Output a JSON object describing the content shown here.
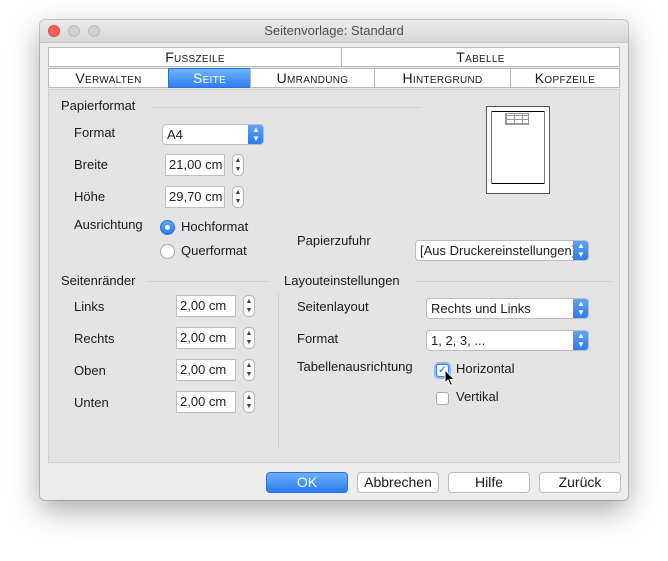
{
  "window": {
    "title": "Seitenvorlage: Standard"
  },
  "tabs_row1": [
    {
      "label": "Fusszeile"
    },
    {
      "label": "Tabelle"
    }
  ],
  "tabs_row2": [
    {
      "label": "Verwalten",
      "active": false
    },
    {
      "label": "Seite",
      "active": true
    },
    {
      "label": "Umrandung",
      "active": false
    },
    {
      "label": "Hintergrund",
      "active": false
    },
    {
      "label": "Kopfzeile",
      "active": false
    }
  ],
  "paper": {
    "heading": "Papierformat",
    "format_label": "Format",
    "format_value": "A4",
    "width_label": "Breite",
    "width_value": "21,00 cm",
    "height_label": "Höhe",
    "height_value": "29,70 cm",
    "orientation_label": "Ausrichtung",
    "portrait_label": "Hochformat",
    "portrait_selected": true,
    "landscape_label": "Querformat",
    "landscape_selected": false,
    "tray_label": "Papierzufuhr",
    "tray_value": "[Aus Druckereinstellungen]"
  },
  "margins": {
    "heading": "Seitenränder",
    "left_label": "Links",
    "left_value": "2,00 cm",
    "right_label": "Rechts",
    "right_value": "2,00 cm",
    "top_label": "Oben",
    "top_value": "2,00 cm",
    "bottom_label": "Unten",
    "bottom_value": "2,00 cm"
  },
  "layout": {
    "heading": "Layouteinstellungen",
    "page_layout_label": "Seitenlayout",
    "page_layout_value": "Rechts und Links",
    "format_label": "Format",
    "format_value": "1, 2, 3, ...",
    "table_alignment_label": "Tabellenausrichtung",
    "horizontal_label": "Horizontal",
    "horizontal_checked": true,
    "vertical_label": "Vertikal",
    "vertical_checked": false
  },
  "buttons": {
    "ok": "OK",
    "cancel": "Abbrechen",
    "help": "Hilfe",
    "back": "Zurück"
  },
  "colors": {
    "accent": "#2a7bf0",
    "close_light": "#fc605c"
  }
}
